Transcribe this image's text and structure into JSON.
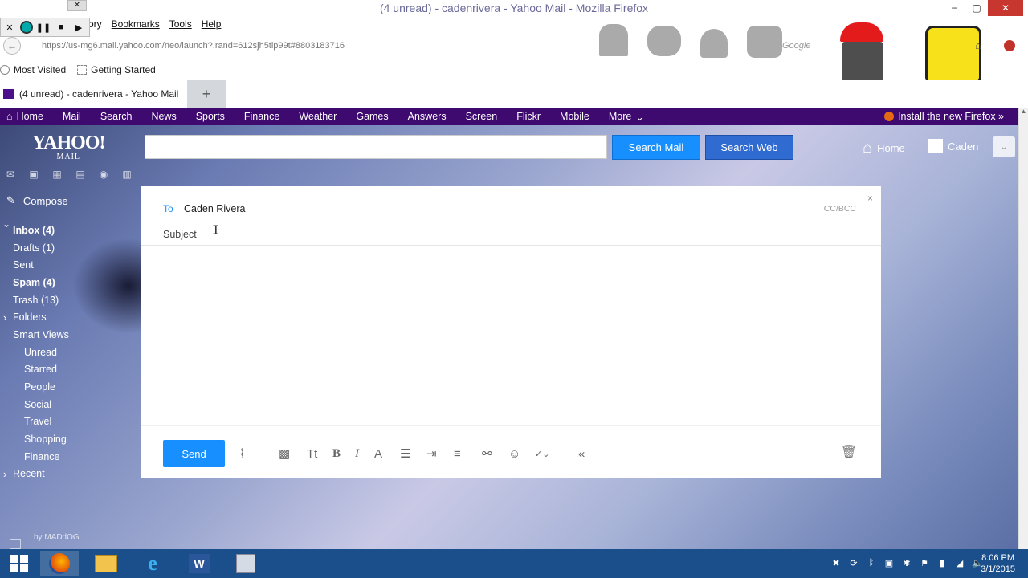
{
  "window": {
    "title": "(4 unread) - cadenrivera - Yahoo Mail - Mozilla Firefox",
    "minimize": "−",
    "maximize": "▢",
    "close": "✕"
  },
  "recorder": {
    "close": "✕",
    "pause": "❚❚",
    "stop": "■",
    "play": "▶",
    "tab_close": "✕"
  },
  "menu": {
    "history": "ory",
    "bookmarks": "Bookmarks",
    "tools": "Tools",
    "help": "Help"
  },
  "urlbar": {
    "url": "https://us-mg6.mail.yahoo.com/neo/launch?.rand=612sjh5tlp99t#8803183716",
    "search_placeholder": "Google"
  },
  "bookmarks": {
    "most_visited": "Most Visited",
    "getting_started": "Getting Started"
  },
  "tabs": {
    "active": "(4 unread) - cadenrivera - Yahoo Mail",
    "new_tab": "+"
  },
  "ynav": {
    "items": [
      "Home",
      "Mail",
      "Search",
      "News",
      "Sports",
      "Finance",
      "Weather",
      "Games",
      "Answers",
      "Screen",
      "Flickr",
      "Mobile",
      "More"
    ],
    "more_caret": "⌄",
    "install": "Install the new Firefox »"
  },
  "header": {
    "logo_top": "YAHOO!",
    "logo_bottom": "MAIL",
    "search_mail": "Search Mail",
    "search_web": "Search Web",
    "home": "Home",
    "user": "Caden"
  },
  "sidebar": {
    "compose": "Compose",
    "folders": [
      {
        "label": "Inbox (4)"
      },
      {
        "label": "Drafts (1)"
      },
      {
        "label": "Sent"
      },
      {
        "label": "Spam (4)"
      },
      {
        "label": "Trash (13)"
      },
      {
        "label": "Folders"
      },
      {
        "label": "Smart Views"
      },
      {
        "label": "Unread"
      },
      {
        "label": "Starred"
      },
      {
        "label": "People"
      },
      {
        "label": "Social"
      },
      {
        "label": "Travel"
      },
      {
        "label": "Shopping"
      },
      {
        "label": "Finance"
      },
      {
        "label": "Recent"
      }
    ],
    "by_line": "by MADdOG"
  },
  "compose": {
    "to_label": "To",
    "to_value": "Caden Rivera",
    "cc_bcc": "CC/BCC",
    "subject_placeholder": "Subject",
    "send": "Send",
    "close": "×"
  },
  "toolbar_icons": [
    "paperclip-icon",
    "sticker-icon",
    "font-size-icon",
    "bold-icon",
    "italic-icon",
    "font-color-icon",
    "bullet-list-icon",
    "indent-icon",
    "align-icon",
    "link-icon",
    "emoji-icon",
    "spellcheck-icon",
    "plain-text-icon",
    "trash-icon"
  ],
  "clock": {
    "time": "8:06 PM",
    "date": "3/1/2015"
  },
  "colors": {
    "yahoo_purple": "#3e0a70",
    "send_blue": "#188fff",
    "taskbar": "#1b4f8c"
  }
}
